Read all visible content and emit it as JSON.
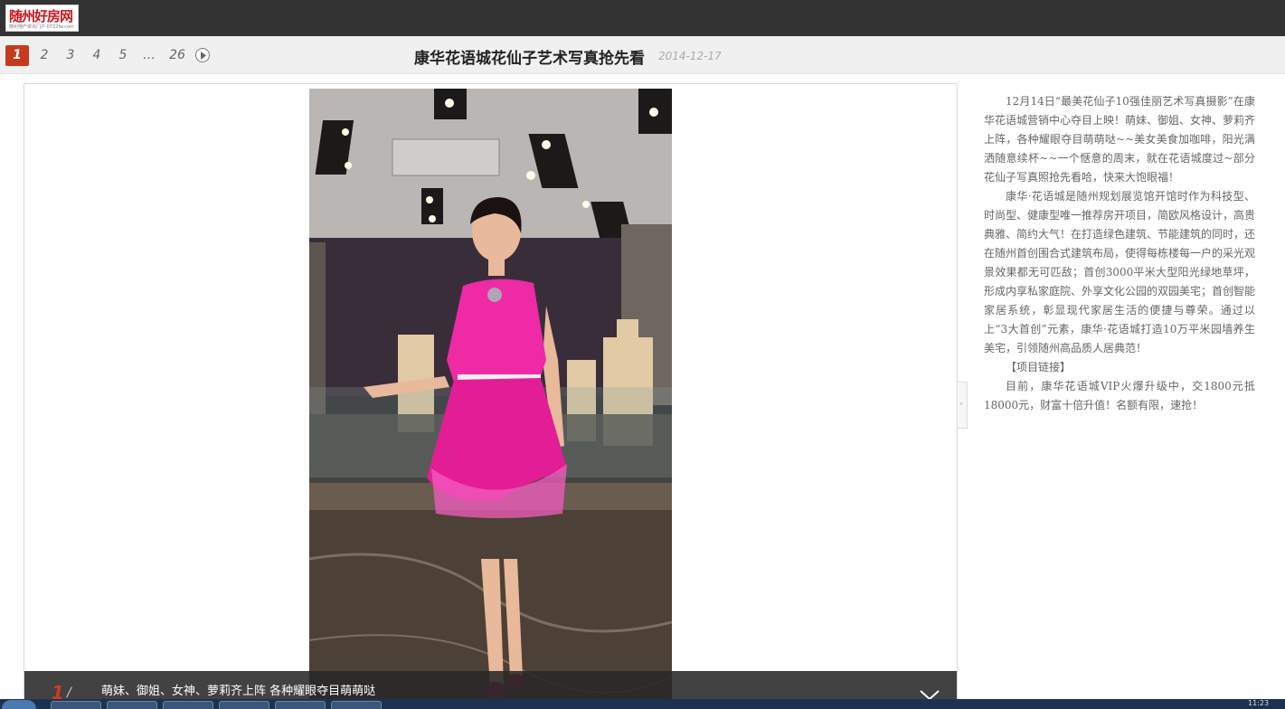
{
  "header": {
    "logo_text": "随州好房网",
    "logo_sub": "随州地产资讯门户·0722fw.com"
  },
  "pager": {
    "pages": [
      "1",
      "2",
      "3",
      "4",
      "5",
      "…",
      "26"
    ],
    "active": "1"
  },
  "article": {
    "title": "康华花语城花仙子艺术写真抢先看",
    "date": "2014-12-17"
  },
  "viewer": {
    "caption_index": "1",
    "caption_sep": "/",
    "caption_text": "萌妹、御姐、女神、萝莉齐上阵 各种耀眼夺目萌萌哒"
  },
  "description": {
    "paragraphs": [
      "12月14日“最美花仙子10强佳丽艺术写真摄影”在康华花语城营销中心夺目上映！萌妹、御姐、女神、萝莉齐上阵，各种耀眼夺目萌萌哒~~美女美食加咖啡，阳光满洒随意续杯~~一个惬意的周末，就在花语城度过~部分花仙子写真照抢先看哈，快来大饱眼福！",
      "康华·花语城是随州规划展览馆开馆时作为科技型、时尚型、健康型唯一推荐房开项目，简欧风格设计，高贵典雅、简约大气！在打造绿色建筑、节能建筑的同时，还在随州首创围合式建筑布局，使得每栋楼每一户的采光观景效果都无可匹敌；首创3000平米大型阳光绿地草坪，形成内享私家庭院、外享文化公园的双园美宅；首创智能家居系统，彰显现代家居生活的便捷与尊荣。通过以上“3大首创”元素，康华·花语城打造10万平米园墙养生美宅，引领随州高品质人居典范！",
      "【项目链接】",
      "目前，康华花语城VIP火爆升级中，交1800元抵18000元，财富十倍升值！名额有限，速抢！"
    ]
  },
  "taskbar": {
    "clock": "11:23"
  },
  "colors": {
    "topbar": "#333333",
    "accent_red": "#c63b1d",
    "dress_pink": "#ee2aa5"
  }
}
